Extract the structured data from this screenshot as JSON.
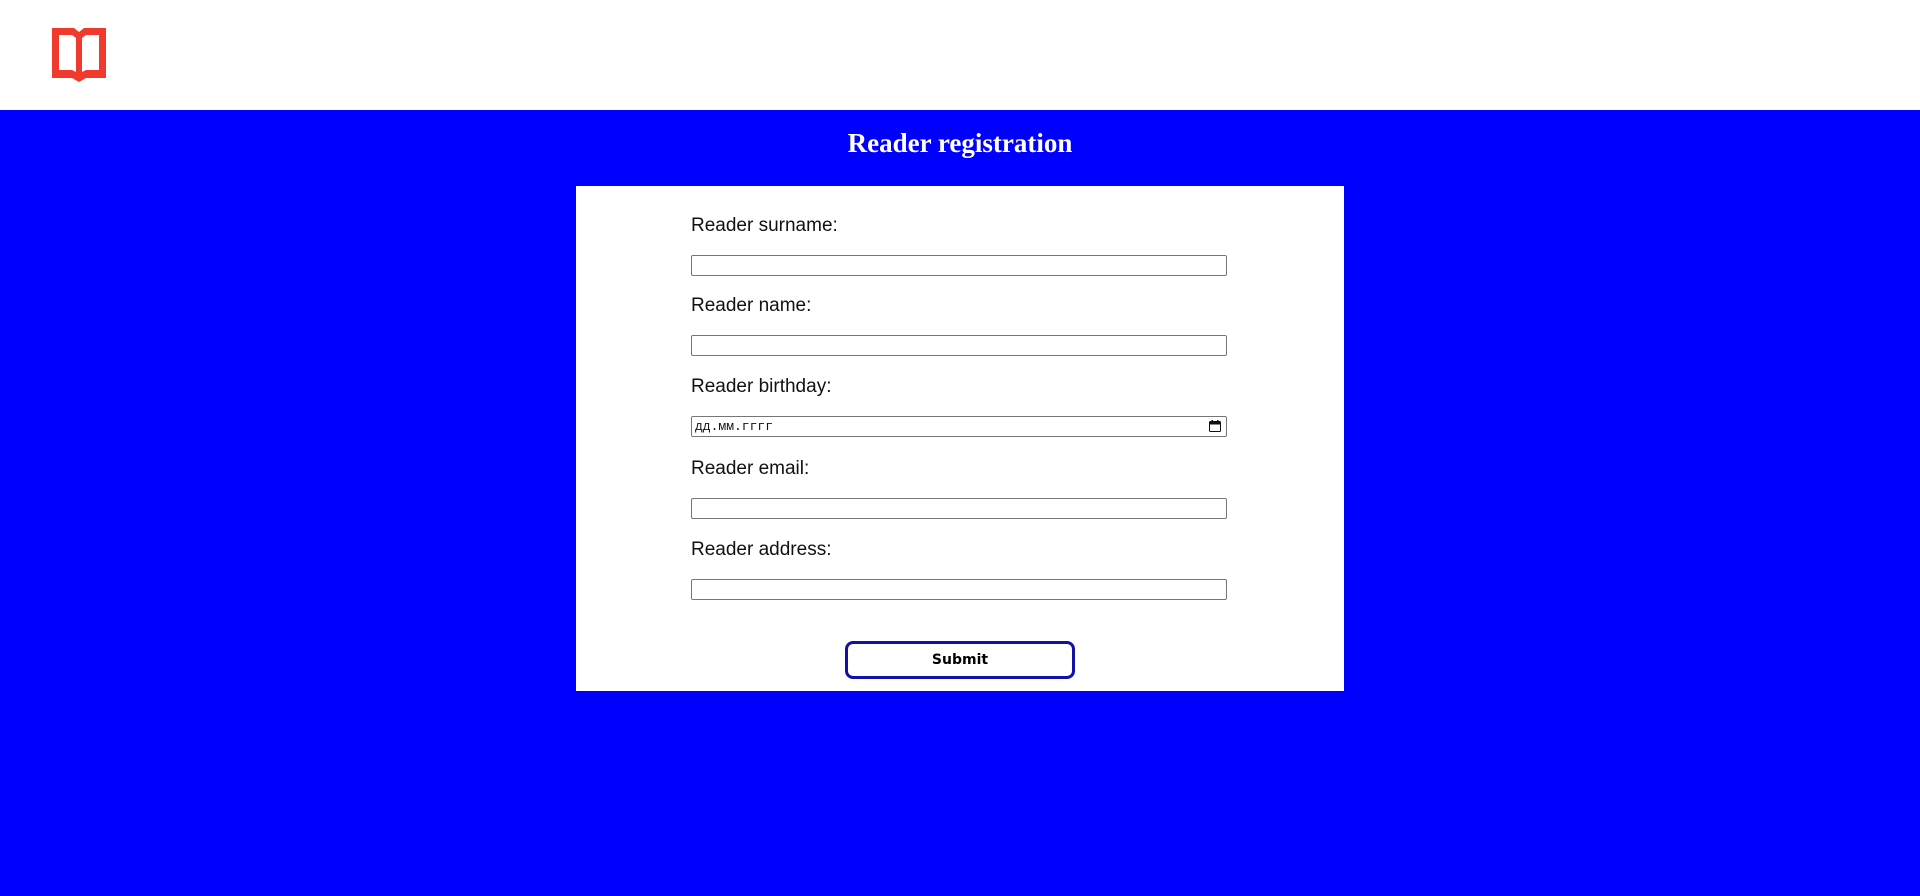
{
  "header": {
    "logo_icon": "open-book-icon",
    "logo_color": "#f03a2e"
  },
  "page": {
    "title": "Reader registration",
    "background_color": "#0000ff"
  },
  "form": {
    "fields": [
      {
        "label": "Reader surname:",
        "value": "",
        "type": "text"
      },
      {
        "label": "Reader name:",
        "value": "",
        "type": "text"
      },
      {
        "label": "Reader birthday:",
        "value": "",
        "placeholder": "дд.мм.гггг",
        "type": "date"
      },
      {
        "label": "Reader email:",
        "value": "",
        "type": "email"
      },
      {
        "label": "Reader address:",
        "value": "",
        "type": "text"
      }
    ],
    "submit_label": "Submit",
    "submit_border_color": "#1111aa"
  }
}
